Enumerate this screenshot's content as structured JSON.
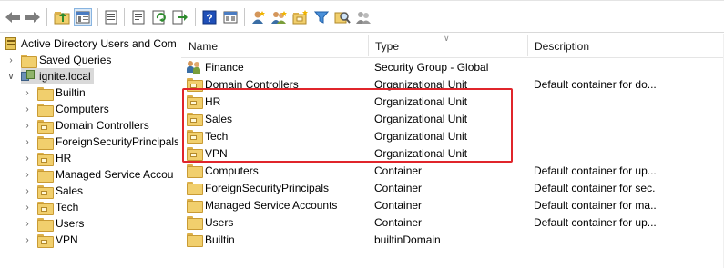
{
  "toolbar": {
    "buttons": [
      "back-arrow-icon",
      "forward-arrow-icon",
      "up-folder-icon",
      "show-hide-tree-icon",
      "properties-icon",
      "export-list-icon",
      "refresh-icon",
      "export-icon",
      "help-icon",
      "view-icon",
      "new-user-icon",
      "new-group-icon",
      "new-ou-icon",
      "filter-icon",
      "find-icon",
      "add-to-group-icon"
    ]
  },
  "tree": {
    "root": "Active Directory Users and Com",
    "saved_queries": "Saved Queries",
    "domain": "ignite.local",
    "children": [
      {
        "label": "Builtin"
      },
      {
        "label": "Computers"
      },
      {
        "label": "Domain Controllers"
      },
      {
        "label": "ForeignSecurityPrincipals"
      },
      {
        "label": "HR"
      },
      {
        "label": "Managed Service Accou"
      },
      {
        "label": "Sales"
      },
      {
        "label": "Tech"
      },
      {
        "label": "Users"
      },
      {
        "label": "VPN"
      }
    ]
  },
  "list": {
    "headers": {
      "name": "Name",
      "type": "Type",
      "description": "Description"
    },
    "rows": [
      {
        "name": "Finance",
        "type": "Security Group - Global",
        "description": "",
        "icon": "group-icon"
      },
      {
        "name": "Domain Controllers",
        "type": "Organizational Unit",
        "description": "Default container for do...",
        "icon": "ou-icon"
      },
      {
        "name": "HR",
        "type": "Organizational Unit",
        "description": "",
        "icon": "ou-icon"
      },
      {
        "name": "Sales",
        "type": "Organizational Unit",
        "description": "",
        "icon": "ou-icon"
      },
      {
        "name": "Tech",
        "type": "Organizational Unit",
        "description": "",
        "icon": "ou-icon"
      },
      {
        "name": "VPN",
        "type": "Organizational Unit",
        "description": "",
        "icon": "ou-icon"
      },
      {
        "name": "Computers",
        "type": "Container",
        "description": "Default container for up...",
        "icon": "folder-icon"
      },
      {
        "name": "ForeignSecurityPrincipals",
        "type": "Container",
        "description": "Default container for sec...",
        "icon": "folder-icon"
      },
      {
        "name": "Managed Service Accounts",
        "type": "Container",
        "description": "Default container for ma...",
        "icon": "folder-icon"
      },
      {
        "name": "Users",
        "type": "Container",
        "description": "Default container for up...",
        "icon": "folder-icon"
      },
      {
        "name": "Builtin",
        "type": "builtinDomain",
        "description": "",
        "icon": "folder-icon"
      }
    ]
  },
  "colors": {
    "highlight_border": "#e0252b",
    "folder": "#f1cf6d",
    "selected_bg": "#d9d9d9"
  }
}
